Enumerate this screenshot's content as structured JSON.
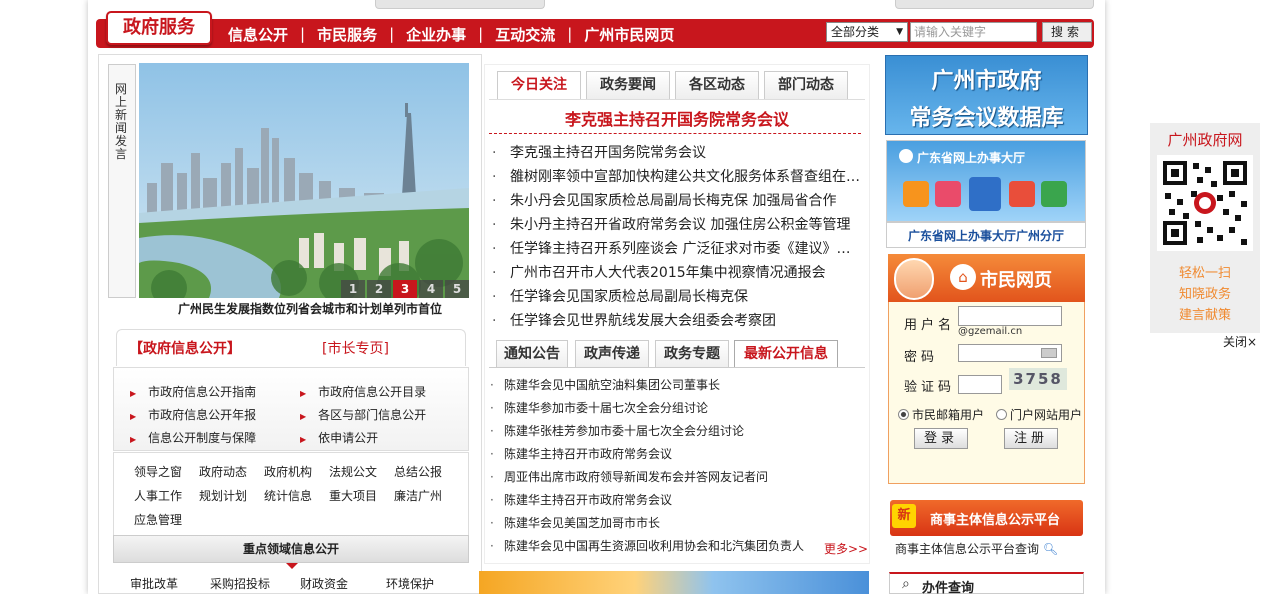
{
  "nav": {
    "title": "政府服务",
    "links": [
      "信息公开",
      "市民服务",
      "企业办事",
      "互动交流",
      "广州市民网页"
    ],
    "separator": "|",
    "search_select": "全部分类",
    "search_placeholder": "请输入关键字",
    "search_button": "搜索"
  },
  "slider": {
    "side_label": "网上新闻发言",
    "caption": "广州民生发展指数位列省会城市和计划单列市首位",
    "pages": [
      "1",
      "2",
      "3",
      "4",
      "5"
    ],
    "active_page": 3
  },
  "info_open": {
    "tab_active": "【政府信息公开】",
    "tab_other": "[市长专页]",
    "items": [
      "市政府信息公开指南",
      "市政府信息公开目录",
      "市政府信息公开年报",
      "各区与部门信息公开",
      "信息公开制度与保障",
      "依申请公开"
    ],
    "keywords": [
      "领导之窗",
      "政府动态",
      "政府机构",
      "法规公文",
      "总结公报",
      "人事工作",
      "规划计划",
      "统计信息",
      "重大项目",
      "廉洁广州",
      "应急管理"
    ],
    "key_area_title": "重点领域信息公开",
    "key_area_items": [
      "审批改革",
      "采购招投标",
      "财政资金",
      "环境保护"
    ]
  },
  "news": {
    "tabs": [
      "今日关注",
      "政务要闻",
      "各区动态",
      "部门动态"
    ],
    "active_tab": 0,
    "headline": "李克强主持召开国务院常务会议",
    "items": [
      "李克强主持召开国务院常务会议",
      "雒树刚率领中宣部加快构建公共文化服务体系督查组在…",
      "朱小丹会见国家质检总局副局长梅克保 加强局省合作",
      "朱小丹主持召开省政府常务会议 加强住房公积金等管理",
      "任学锋主持召开系列座谈会 广泛征求对市委《建议》…",
      "广州市召开市人大代表2015年集中视察情况通报会",
      "任学锋会见国家质检总局副局长梅克保",
      "任学锋会见世界航线发展大会组委会考察团"
    ]
  },
  "notices": {
    "tabs": [
      "通知公告",
      "政声传递",
      "政务专题",
      "最新公开信息"
    ],
    "active_tab": 3,
    "items": [
      "陈建华会见中国航空油料集团公司董事长",
      "陈建华参加市委十届七次全会分组讨论",
      "陈建华张桂芳参加市委十届七次全会分组讨论",
      "陈建华主持召开市政府常务会议",
      "周亚伟出席市政府领导新闻发布会并答网友记者问",
      "陈建华主持召开市政府常务会议",
      "陈建华会见美国芝加哥市市长",
      "陈建华会见中国再生资源回收利用协会和北汽集团负责人"
    ],
    "more": "更多>>"
  },
  "right": {
    "banner1_line1": "广州市政府",
    "banner1_line2": "常务会议数据库",
    "banner2_title": "广东省网上办事大厅",
    "banner2_caption": "广东省网上办事大厅广州分厅",
    "login": {
      "title": "市民网页",
      "username_label": "用户名",
      "username_hint": "@gzemail.cn",
      "password_label": "密码",
      "captcha_label": "验证码",
      "captcha_value": "3758",
      "radio1": "市民邮箱用户",
      "radio2": "门户网站用户",
      "login_button": "登录",
      "register_button": "注册"
    },
    "banner3_new": "新",
    "banner3_title": "商事主体信息公示平台",
    "banner3_caption": "商事主体信息公示平台查询",
    "search_title": "办件查询"
  },
  "qr": {
    "title": "广州政府网",
    "lines": [
      "轻松一扫",
      "知晓政务",
      "建言献策"
    ],
    "close": "关闭×"
  }
}
